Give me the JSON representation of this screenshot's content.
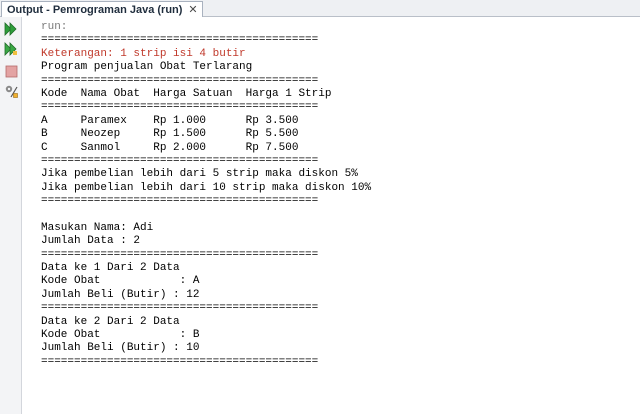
{
  "window": {
    "tab_title": "Output - Pemrograman Java (run)",
    "close_glyph": "✕"
  },
  "toolbar": {
    "icons": [
      "rerun-icon",
      "rerun-with-options-icon",
      "stop-icon",
      "settings-icon"
    ]
  },
  "colors": {
    "error_text": "#c0392b",
    "run_icon": "#2e9e3b",
    "stop_icon": "#d98080"
  },
  "output": {
    "lines": [
      {
        "text": "run:",
        "style": "dim"
      },
      {
        "text": "==========================================",
        "style": ""
      },
      {
        "text": "Keterangan: 1 strip isi 4 butir",
        "style": "err"
      },
      {
        "text": "Program penjualan Obat Terlarang",
        "style": ""
      },
      {
        "text": "==========================================",
        "style": ""
      },
      {
        "text": "Kode  Nama Obat  Harga Satuan  Harga 1 Strip",
        "style": ""
      },
      {
        "text": "==========================================",
        "style": ""
      },
      {
        "text": "A     Paramex    Rp 1.000      Rp 3.500",
        "style": ""
      },
      {
        "text": "B     Neozep     Rp 1.500      Rp 5.500",
        "style": ""
      },
      {
        "text": "C     Sanmol     Rp 2.000      Rp 7.500",
        "style": ""
      },
      {
        "text": "==========================================",
        "style": ""
      },
      {
        "text": "Jika pembelian lebih dari 5 strip maka diskon 5%",
        "style": ""
      },
      {
        "text": "Jika pembelian lebih dari 10 strip maka diskon 10%",
        "style": ""
      },
      {
        "text": "==========================================",
        "style": ""
      },
      {
        "text": "",
        "style": ""
      },
      {
        "text": "Masukan Nama: Adi",
        "style": ""
      },
      {
        "text": "Jumlah Data : 2",
        "style": ""
      },
      {
        "text": "==========================================",
        "style": ""
      },
      {
        "text": "Data ke 1 Dari 2 Data",
        "style": ""
      },
      {
        "text": "Kode Obat            : A",
        "style": ""
      },
      {
        "text": "Jumlah Beli (Butir) : 12",
        "style": ""
      },
      {
        "text": "==========================================",
        "style": ""
      },
      {
        "text": "Data ke 2 Dari 2 Data",
        "style": ""
      },
      {
        "text": "Kode Obat            : B",
        "style": ""
      },
      {
        "text": "Jumlah Beli (Butir) : 10",
        "style": ""
      },
      {
        "text": "==========================================",
        "style": ""
      }
    ]
  }
}
